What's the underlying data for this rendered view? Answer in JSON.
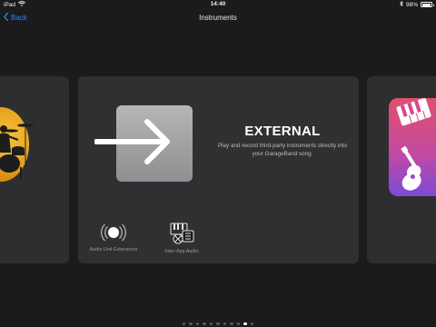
{
  "status_bar": {
    "device": "iPad",
    "time": "14:40",
    "battery": "98%",
    "battery_level": 0.98
  },
  "nav": {
    "back_label": "Back",
    "title": "Instruments"
  },
  "center_card": {
    "title": "EXTERNAL",
    "description": "Play and record third-party instruments directly into your GarageBand song.",
    "icon": "arrow-right-icon",
    "options": [
      {
        "label": "Audio Unit Extensions",
        "icon": "audio-unit-extensions-icon"
      },
      {
        "label": "Inter-App Audio",
        "icon": "inter-app-audio-icon"
      }
    ]
  },
  "left_card": {
    "icon": "drummer-icon"
  },
  "right_card": {
    "icon": "piano-guitar-icon"
  },
  "pager": {
    "count": 11,
    "active_index": 9
  },
  "colors": {
    "accent": "#2e86f0",
    "drum_orange": "#f0a82a",
    "instrument_gradient": [
      "#e0506a",
      "#c44aa0",
      "#7d4ad6"
    ]
  }
}
